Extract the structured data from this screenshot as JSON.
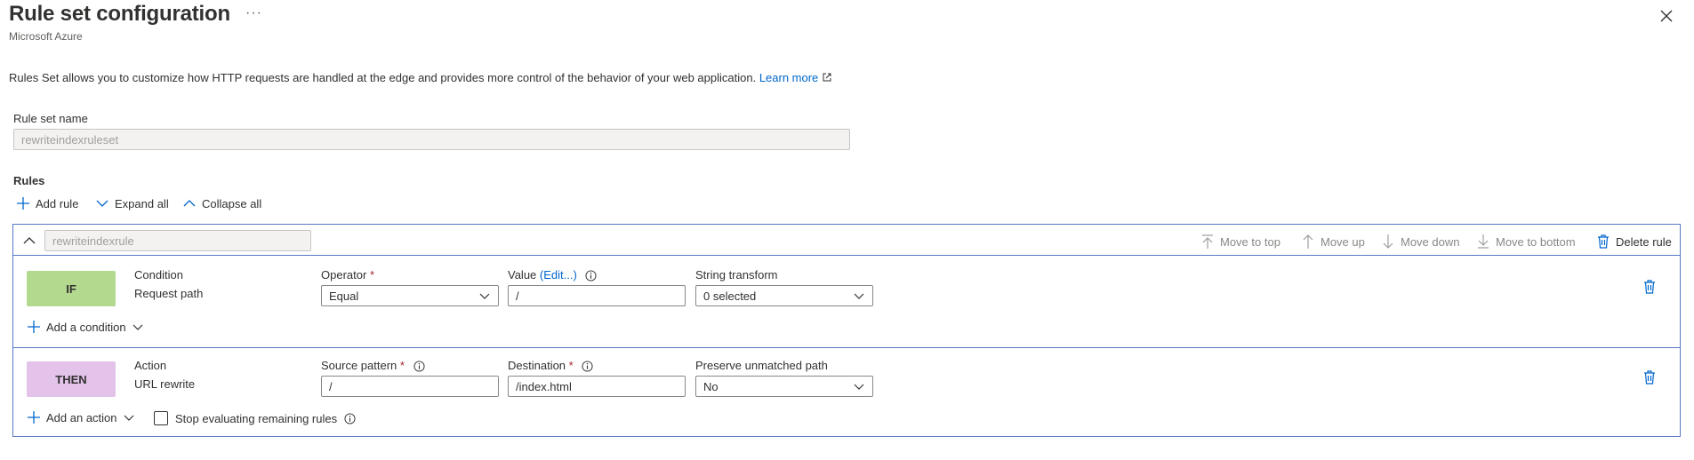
{
  "header": {
    "title": "Rule set configuration",
    "subtitle": "Microsoft Azure",
    "more_label": "···",
    "description": "Rules Set allows you to customize how HTTP requests are handled at the edge and provides more control of the behavior of your web application.",
    "learn_more": "Learn more"
  },
  "rule_set": {
    "name_label": "Rule set name",
    "name_value": "rewriteindexruleset"
  },
  "rules": {
    "section_label": "Rules",
    "toolbar": {
      "add_rule": "Add rule",
      "expand_all": "Expand all",
      "collapse_all": "Collapse all"
    },
    "rule": {
      "name_value": "rewriteindexrule",
      "actions": {
        "move_to_top": "Move to top",
        "move_up": "Move up",
        "move_down": "Move down",
        "move_to_bottom": "Move to bottom",
        "delete_rule": "Delete rule"
      },
      "condition": {
        "badge": "IF",
        "type_label": "Condition",
        "type_value": "Request path",
        "operator_label": "Operator",
        "operator_value": "Equal",
        "value_label": "Value",
        "value_edit": "(Edit...)",
        "value_value": "/",
        "transform_label": "String transform",
        "transform_value": "0 selected",
        "add_condition": "Add a condition"
      },
      "action": {
        "badge": "THEN",
        "type_label": "Action",
        "type_value": "URL rewrite",
        "source_label": "Source pattern",
        "source_value": "/",
        "destination_label": "Destination",
        "destination_value": "/index.html",
        "preserve_label": "Preserve unmatched path",
        "preserve_value": "No",
        "add_action": "Add an action",
        "stop_label": "Stop evaluating remaining rules"
      }
    }
  },
  "colors": {
    "accent_blue": "#0066cc",
    "card_border": "#5b78c7",
    "if_badge": "#b3d98e",
    "then_badge": "#e3c3ea",
    "required": "#a4262c"
  }
}
